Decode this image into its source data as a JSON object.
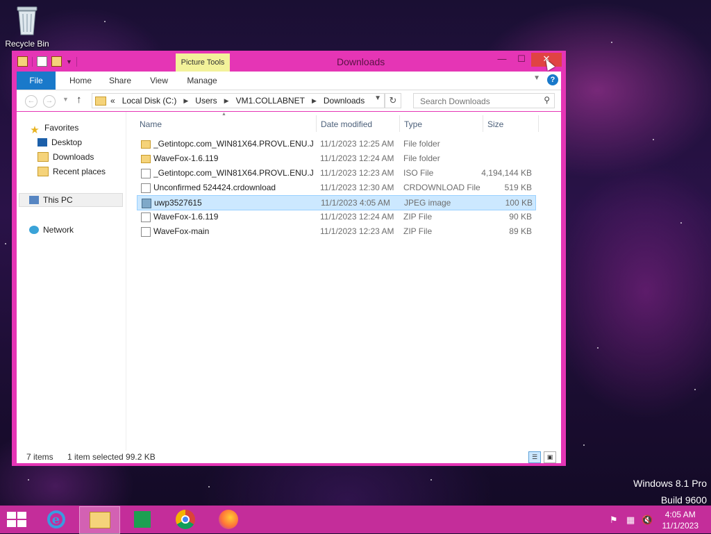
{
  "desktop": {
    "recycle_bin_label": "Recycle Bin",
    "watermark_line1": "Windows 8.1 Pro",
    "watermark_line2": "Build 9600"
  },
  "window": {
    "title": "Downloads",
    "contextual_tab": "Picture Tools",
    "buttons": {
      "minimize": "—",
      "maximize": "☐",
      "close": "✕"
    }
  },
  "ribbon": {
    "tabs": [
      "File",
      "Home",
      "Share",
      "View",
      "Manage"
    ]
  },
  "address_bar": {
    "prefix": "«",
    "crumbs": [
      "Local Disk (C:)",
      "Users",
      "VM1.COLLABNET",
      "Downloads"
    ]
  },
  "search": {
    "placeholder": "Search Downloads"
  },
  "nav_pane": {
    "favorites": "Favorites",
    "desktop": "Desktop",
    "downloads": "Downloads",
    "recent_places": "Recent places",
    "this_pc": "This PC",
    "network": "Network"
  },
  "columns": {
    "name": "Name",
    "date": "Date modified",
    "type": "Type",
    "size": "Size"
  },
  "files": [
    {
      "name": "_Getintopc.com_WIN81X64.PROVL.ENU.J...",
      "date": "11/1/2023 12:25 AM",
      "type": "File folder",
      "size": "",
      "icon": "folder"
    },
    {
      "name": "WaveFox-1.6.119",
      "date": "11/1/2023 12:24 AM",
      "type": "File folder",
      "size": "",
      "icon": "folder"
    },
    {
      "name": "_Getintopc.com_WIN81X64.PROVL.ENU.J...",
      "date": "11/1/2023 12:23 AM",
      "type": "ISO File",
      "size": "4,194,144 KB",
      "icon": "file"
    },
    {
      "name": "Unconfirmed 524424.crdownload",
      "date": "11/1/2023 12:30 AM",
      "type": "CRDOWNLOAD File",
      "size": "519 KB",
      "icon": "file"
    },
    {
      "name": "uwp3527615",
      "date": "11/1/2023 4:05 AM",
      "type": "JPEG image",
      "size": "100 KB",
      "icon": "image",
      "selected": true
    },
    {
      "name": "WaveFox-1.6.119",
      "date": "11/1/2023 12:24 AM",
      "type": "ZIP File",
      "size": "90 KB",
      "icon": "file"
    },
    {
      "name": "WaveFox-main",
      "date": "11/1/2023 12:23 AM",
      "type": "ZIP File",
      "size": "89 KB",
      "icon": "file"
    }
  ],
  "status": {
    "items": "7 items",
    "selection": "1 item selected  99.2 KB"
  },
  "taskbar": {
    "clock_time": "4:05 AM",
    "clock_date": "11/1/2023"
  },
  "colors": {
    "window_frame": "#e535b5",
    "taskbar": "#c42d9a",
    "selection": "#cce8ff",
    "file_tab": "#1979ca"
  }
}
